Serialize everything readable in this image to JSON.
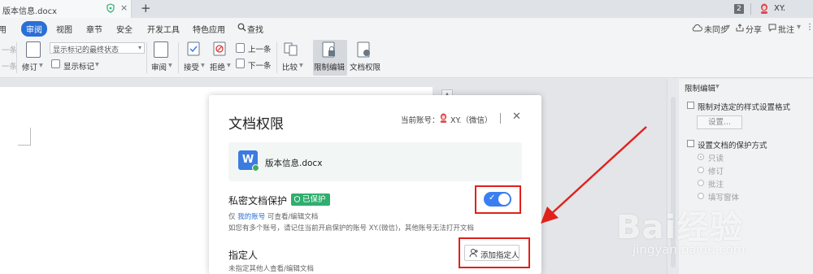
{
  "tabbar": {
    "doc_tab_title": "版本信息.docx",
    "close_glyph": "×",
    "new_tab_glyph": "+",
    "window_count": "2",
    "user_name": "XY."
  },
  "menu": {
    "items": [
      "用",
      "审阅",
      "视图",
      "章节",
      "安全",
      "开发工具",
      "特色应用",
      "查找"
    ],
    "right": [
      "未同步",
      "分享",
      "批注"
    ]
  },
  "ribbon": {
    "cut_prev": "一条",
    "cut_next": "一条",
    "track_changes": "修订",
    "markup_select": "显示标记的最终状态",
    "show_markup": "显示标记",
    "review": "审阅",
    "accept": "接受",
    "reject": "拒绝",
    "previous": "上一条",
    "next": "下一条",
    "compare": "比较",
    "restrict_editing": "限制编辑",
    "doc_permission": "文档权限"
  },
  "right_pane": {
    "title": "限制编辑",
    "opt_format": "限制对选定的样式设置格式",
    "settings_button": "设置...",
    "opt_protect": "设置文档的保护方式",
    "radio_readonly": "只读",
    "radio_revision": "修订",
    "radio_comment": "批注",
    "radio_form": "填写窗体"
  },
  "dialog": {
    "title": "文档权限",
    "account_label": "当前账号：",
    "account_name": "XY.（微信）",
    "file_icon_letter": "W",
    "file_name": "版本信息.docx",
    "private_title": "私密文档保护",
    "protected_badge": "已保护",
    "desc1_prefix": "仅",
    "desc1_link": "我的账号",
    "desc1_suffix": "可查看/编辑文档",
    "desc2": "如您有多个账号，请记住当前开启保护的账号 XY.(微信)，其他账号无法打开文档",
    "designee_title": "指定人",
    "add_designee": "添加指定人",
    "designee_desc": "未指定其他人查看/编辑文档"
  },
  "toggle": {
    "checked": true
  },
  "colors": {
    "accent_blue": "#2b6fd6",
    "toggle_blue": "#3b7ef0",
    "badge_green": "#2fae6e",
    "annotation_red": "#e0211b"
  },
  "watermark": {
    "logo": "Bai经验",
    "url": "jingyan.baidu.com"
  }
}
